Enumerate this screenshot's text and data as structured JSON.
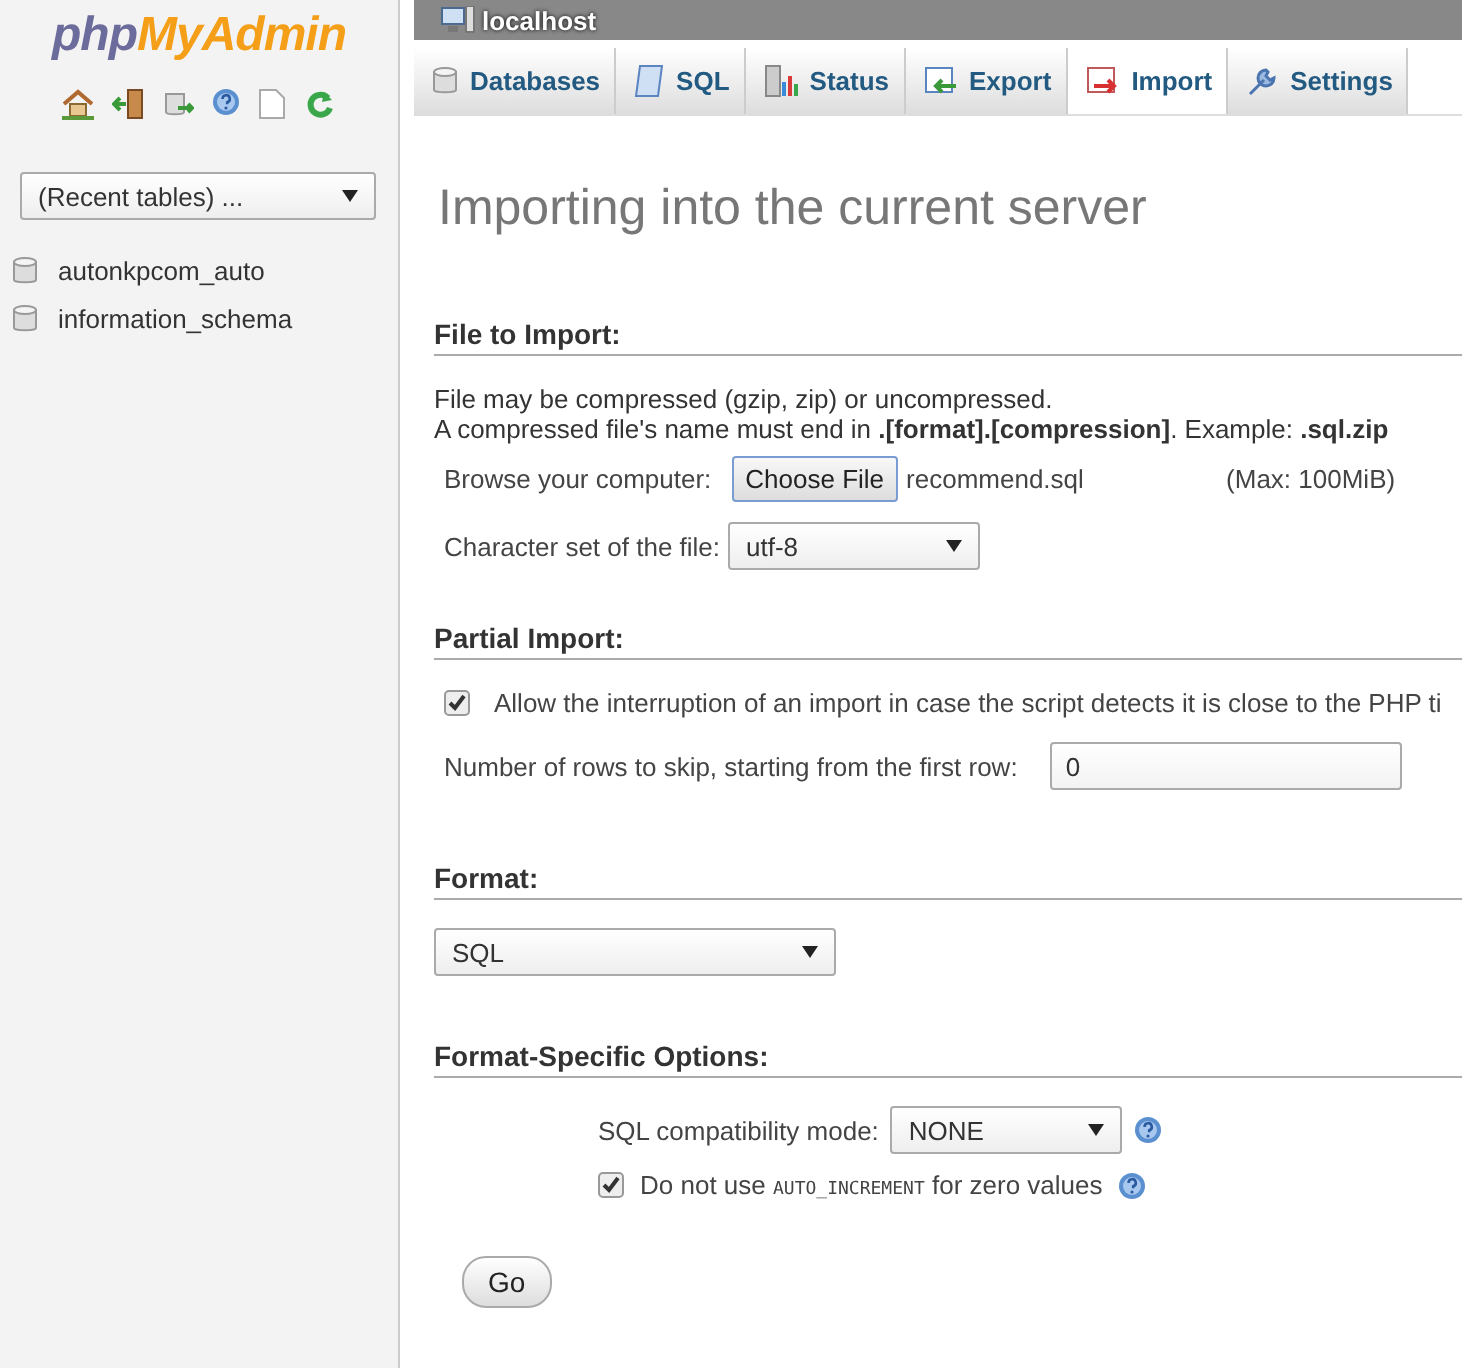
{
  "sidebar": {
    "logo": {
      "part1": "php",
      "part2": "MyAdmin"
    },
    "recent_tables": {
      "value": "(Recent tables) ..."
    },
    "databases": [
      {
        "name": "autonkpcom_auto"
      },
      {
        "name": "information_schema"
      }
    ]
  },
  "breadcrumb": {
    "server": "localhost"
  },
  "tabs": [
    {
      "label": "Databases",
      "kind": "db",
      "selected": false
    },
    {
      "label": "SQL",
      "kind": "sql",
      "selected": false
    },
    {
      "label": "Status",
      "kind": "status",
      "selected": false
    },
    {
      "label": "Export",
      "kind": "export",
      "selected": false
    },
    {
      "label": "Import",
      "kind": "import",
      "selected": true
    },
    {
      "label": "Settings",
      "kind": "settings",
      "selected": false
    }
  ],
  "page_title": "Importing into the current server",
  "file_to_import": {
    "heading": "File to Import:",
    "note_1": "File may be compressed (gzip, zip) or uncompressed.",
    "note_2": "A compressed file's name must end in **.[format].[compression]**. Example: **.sql.zip**",
    "browse_label": "Browse your computer:",
    "choose_button": "Choose File",
    "file_name": "recommend.sql",
    "max_size": "(Max: 100MiB)",
    "charset_label": "Character set of the file:",
    "charset_value": "utf-8"
  },
  "partial_import": {
    "heading": "Partial Import:",
    "allow_interrupt": {
      "label": "Allow the interruption of an import in case the script detects it is close to the PHP ti",
      "checked": true
    },
    "skip_label": "Number of rows to skip, starting from the first row:",
    "skip_value": "0"
  },
  "format": {
    "heading": "Format:",
    "value": "SQL"
  },
  "format_options": {
    "heading": "Format-Specific Options:",
    "compat_label": "SQL compatibility mode:",
    "compat_value": "NONE",
    "no_auto_increment": {
      "label_before": "Do not use",
      "code": "AUTO_INCREMENT",
      "label_after": "for zero values",
      "checked": true
    }
  },
  "go_button": "Go"
}
